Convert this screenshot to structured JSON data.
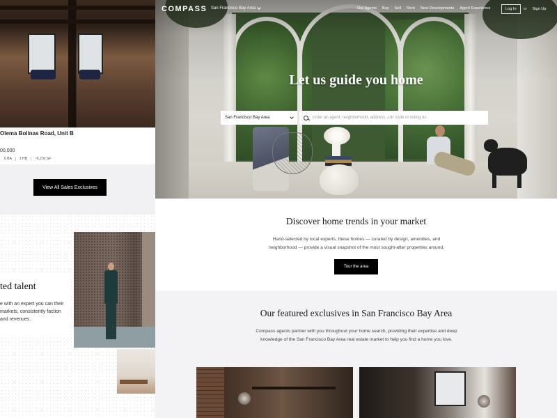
{
  "left_page": {
    "listing_title": "Olema Bolinas Road, Unit B",
    "listing_price": "00,000",
    "listing_specs": [
      "6 BA",
      "1 HB",
      "~6,230 SF"
    ],
    "view_all_button": "View All Sales Exclusives",
    "talent_title": "ted talent",
    "talent_text": "e with an expert you can their markets, consistently faction and revenues."
  },
  "nav": {
    "logo": "COMPASS",
    "market": "San Francisco Bay Area",
    "links": [
      "Our Agents",
      "Buy",
      "Sell",
      "Rent",
      "New Developments",
      "Agent Experience"
    ],
    "login": "Log In",
    "or": "or",
    "signup": "Sign Up"
  },
  "hero": {
    "title": "Let us guide you home",
    "market_select": "San Francisco Bay Area",
    "search_placeholder": "Enter an agent, neighborhood, address, ZIP code or listing ID"
  },
  "trends": {
    "title": "Discover home trends in your market",
    "text": "Hand-selected by local experts, these homes — curated by design, amenities, and neighborhood — provide a visual snapshot of the most sought-after properties around.",
    "button": "Tour the area"
  },
  "featured": {
    "title": "Our featured exclusives in San Francisco Bay Area",
    "text": "Compass agents partner with you throughout your home search, providing their expertise and deep knowledge of the San Francisco Bay Area real estate market to help you find a home you love."
  },
  "icons": {
    "search": "search-icon",
    "chevron": "chevron-down-icon"
  },
  "colors": {
    "accent": "#000000",
    "section_gray": "#f3f3f5"
  }
}
